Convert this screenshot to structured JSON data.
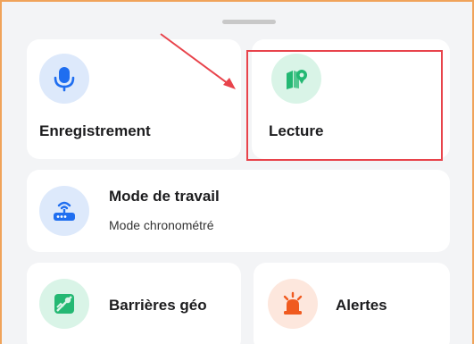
{
  "tiles": {
    "recording": {
      "label": "Enregistrement",
      "icon": "microphone-icon"
    },
    "playback": {
      "label": "Lecture",
      "icon": "map-pin-icon"
    },
    "work_mode": {
      "label": "Mode de travail",
      "value": "Mode chronométré",
      "icon": "router-icon"
    },
    "geofence": {
      "label": "Barrières géo",
      "icon": "geofence-map-icon"
    },
    "alerts": {
      "label": "Alertes",
      "icon": "siren-icon"
    }
  },
  "colors": {
    "blue_icon": "#1f6ef0",
    "green_icon": "#24b873",
    "orange_icon": "#f05a1f",
    "highlight": "#e8434b",
    "frame_border": "#f0a35a"
  }
}
